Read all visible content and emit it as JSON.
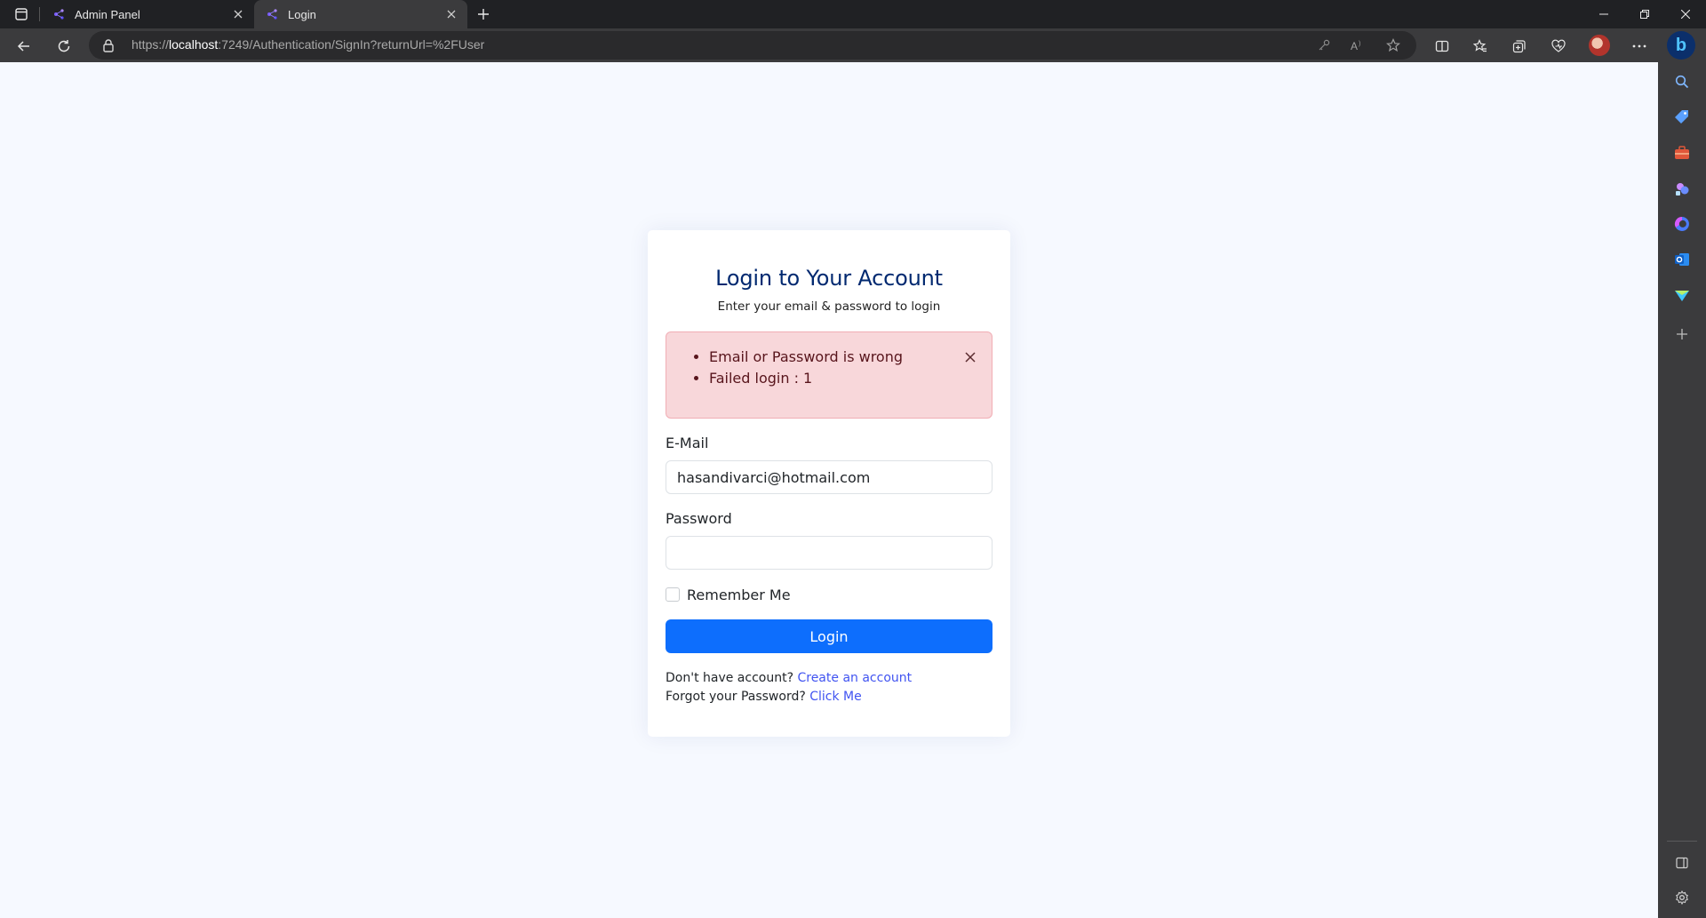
{
  "browser": {
    "tabs": [
      {
        "title": "Admin Panel",
        "active": false
      },
      {
        "title": "Login",
        "active": true
      }
    ],
    "url_scheme": "https://",
    "url_host": "localhost",
    "url_rest": ":7249/Authentication/SignIn?returnUrl=%2FUser",
    "accent": "#0d6efd"
  },
  "login": {
    "title": "Login to Your Account",
    "subtitle": "Enter your email & password to login",
    "errors": [
      "Email or Password is wrong",
      "Failed login : 1"
    ],
    "email_label": "E-Mail",
    "email_value": "hasandivarci@hotmail.com",
    "password_label": "Password",
    "password_value": "",
    "remember_label": "Remember Me",
    "remember_checked": false,
    "submit_label": "Login",
    "no_account_text": "Don't have account?",
    "create_account_link": "Create an account",
    "forgot_text": "Forgot your Password?",
    "forgot_link": "Click Me"
  },
  "colors": {
    "page_bg": "#f6f9ff",
    "title": "#012970",
    "alert_bg": "#f8d7da",
    "link": "#4154f1",
    "button": "#0d6efd"
  }
}
